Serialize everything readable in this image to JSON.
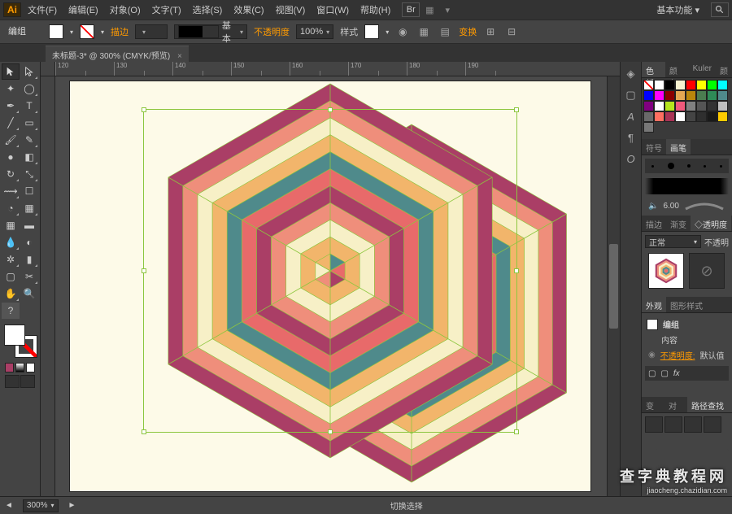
{
  "menubar": {
    "items": [
      "文件(F)",
      "编辑(E)",
      "对象(O)",
      "文字(T)",
      "选择(S)",
      "效果(C)",
      "视图(V)",
      "窗口(W)",
      "帮助(H)"
    ],
    "workspace": "基本功能 ▾"
  },
  "controlbar": {
    "selection_label": "编组",
    "stroke_label": "描边",
    "stroke_weight": " ",
    "basic_label": "基本",
    "opacity_label": "不透明度",
    "opacity_value": "100%",
    "style_label": "样式",
    "transform_label": "变换"
  },
  "doctab": {
    "title": "未标题-3* @ 300% (CMYK/预览)"
  },
  "ruler_ticks": [
    "120",
    "130",
    "140",
    "150",
    "160",
    "170",
    "180",
    "190"
  ],
  "statusbar": {
    "zoom": "300%",
    "tool_hint": "切换选择"
  },
  "panels": {
    "color_tabs": [
      "色板",
      "颜色",
      "Kuler",
      "颜"
    ],
    "brush_tabs": [
      "符号",
      "画笔"
    ],
    "brush_value": "6.00",
    "trans_tabs": [
      "描边",
      "渐变",
      "◇透明度"
    ],
    "blend_mode": "正常",
    "opacity_label": "不透明",
    "appear_tabs": [
      "外观",
      "图形样式"
    ],
    "appear_title": "编组",
    "appear_content": "内容",
    "appear_opacity_label": "不透明度:",
    "appear_opacity_value": "默认值",
    "pathfinder_tabs": [
      "变换",
      "对齐",
      "路径查找器"
    ]
  },
  "swatches": [
    "#ffffff",
    "#000000",
    "#f7f2d0",
    "#ff0000",
    "#ffff00",
    "#00ff00",
    "#00ffff",
    "#0000ff",
    "#ff00ff",
    "#8b0000",
    "#e4a853",
    "#b8860b",
    "#4b7c50",
    "#2e8b57",
    "#4f8a8b",
    "#800080",
    "#ffffff",
    "#b5e61d",
    "#ef597b",
    "#808080",
    "#555555",
    "#333333",
    "#c0c0c0",
    "#696969",
    "#ff6f61",
    "#aa3355",
    "#ffffff",
    "#444444",
    "#2f2f2f",
    "#1a1a1a",
    "#ffcc00",
    "#777777"
  ],
  "hex_colors": [
    "#aa3e66",
    "#ef8e7b",
    "#f7f0c7",
    "#f2b56b",
    "#4f8a8b",
    "#e86a6a"
  ],
  "watermark": {
    "line1": "查字典教程网",
    "line2": "jiaocheng.chazidian.com"
  }
}
